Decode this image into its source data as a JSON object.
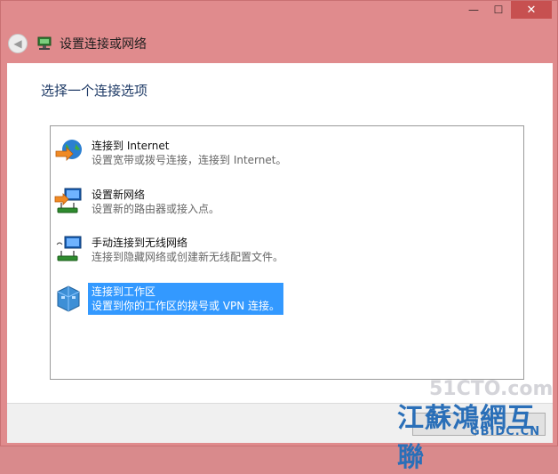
{
  "window": {
    "title": "设置连接或网络",
    "controls": {
      "minimize": "—",
      "maximize": "☐",
      "close": "✕"
    }
  },
  "page": {
    "heading": "选择一个连接选项"
  },
  "options": [
    {
      "title": "连接到 Internet",
      "desc": "设置宽带或拨号连接，连接到 Internet。",
      "icon": "globe-icon"
    },
    {
      "title": "设置新网络",
      "desc": "设置新的路由器或接入点。",
      "icon": "new-network-icon"
    },
    {
      "title": "手动连接到无线网络",
      "desc": "连接到隐藏网络或创建新无线配置文件。",
      "icon": "wireless-network-icon"
    },
    {
      "title": "连接到工作区",
      "desc": "设置到你的工作区的拨号或 VPN 连接。",
      "icon": "workplace-icon",
      "selected": true
    }
  ],
  "watermark": {
    "line1": "51CTO.com",
    "line2": "江蘇鴻網互聯",
    "line3": "GBIDC.CN"
  },
  "colors": {
    "frame": "#e08b8d",
    "selection": "#3399ff",
    "heading": "#1e3a66"
  }
}
